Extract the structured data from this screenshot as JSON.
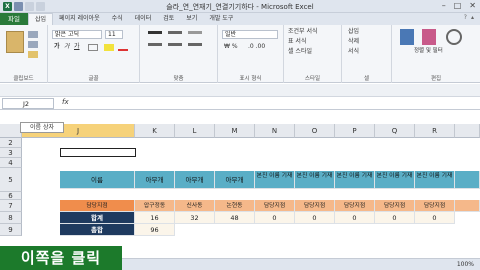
{
  "window": {
    "title": "슬라_연_연재기_연결기기하다 - Microsoft Excel",
    "minimize": "–",
    "restore": "□",
    "close": "✕"
  },
  "tabs": [
    {
      "label": "파일"
    },
    {
      "label": "삽입"
    },
    {
      "label": "페이지 레이아웃"
    },
    {
      "label": "수식"
    },
    {
      "label": "데이터"
    },
    {
      "label": "검토"
    },
    {
      "label": "보기"
    },
    {
      "label": "개발 도구"
    }
  ],
  "ribbon": {
    "clipboard_label": "클립보드",
    "font_name": "맑은 고딕",
    "font_size": "11",
    "font_label": "글꼴",
    "align_label": "맞춤",
    "number_label": "표시 형식",
    "number_format": "일반",
    "styles_label": "스타일",
    "cells_label": "셀",
    "edit_label": "편집",
    "cond_format": "조건부 서식",
    "table_format": "표 서식",
    "cell_style": "셀 스타일",
    "insert": "삽입",
    "delete": "삭제",
    "format": "서식",
    "sort": "정렬 및 필터",
    "find": "찾기 및 선택"
  },
  "formula": {
    "namebox": "J2",
    "fx": "fx",
    "value": ""
  },
  "tooltip": "이름 상자",
  "columns": [
    "J",
    "K",
    "L",
    "M",
    "N",
    "O",
    "P",
    "Q",
    "R"
  ],
  "rows": [
    "2",
    "3",
    "4",
    "5",
    "6",
    "7",
    "8",
    "9"
  ],
  "table": {
    "row5": [
      "이름",
      "아무개",
      "아무개",
      "아무개",
      "본진 이름 기재",
      "본진 이름 기재",
      "본진 이름 기재",
      "본진 이름 기재",
      "본진 이름 기재"
    ],
    "row7": [
      "담당지점",
      "압구정동",
      "신사동",
      "논현동",
      "담당지점",
      "담당지점",
      "담당지점",
      "담당지점",
      "담당지점"
    ],
    "row8": [
      "합계",
      "16",
      "32",
      "48",
      "0",
      "0",
      "0",
      "0",
      "0"
    ],
    "row9": [
      "총합",
      "96"
    ]
  },
  "caption": "이쪽을 클릭",
  "status": {
    "zoom": "100%"
  },
  "colors": {
    "header": "#5aaec6",
    "orange": "#f5b88a",
    "navy": "#1e3a5f",
    "file_tab": "#2a7a3a"
  }
}
